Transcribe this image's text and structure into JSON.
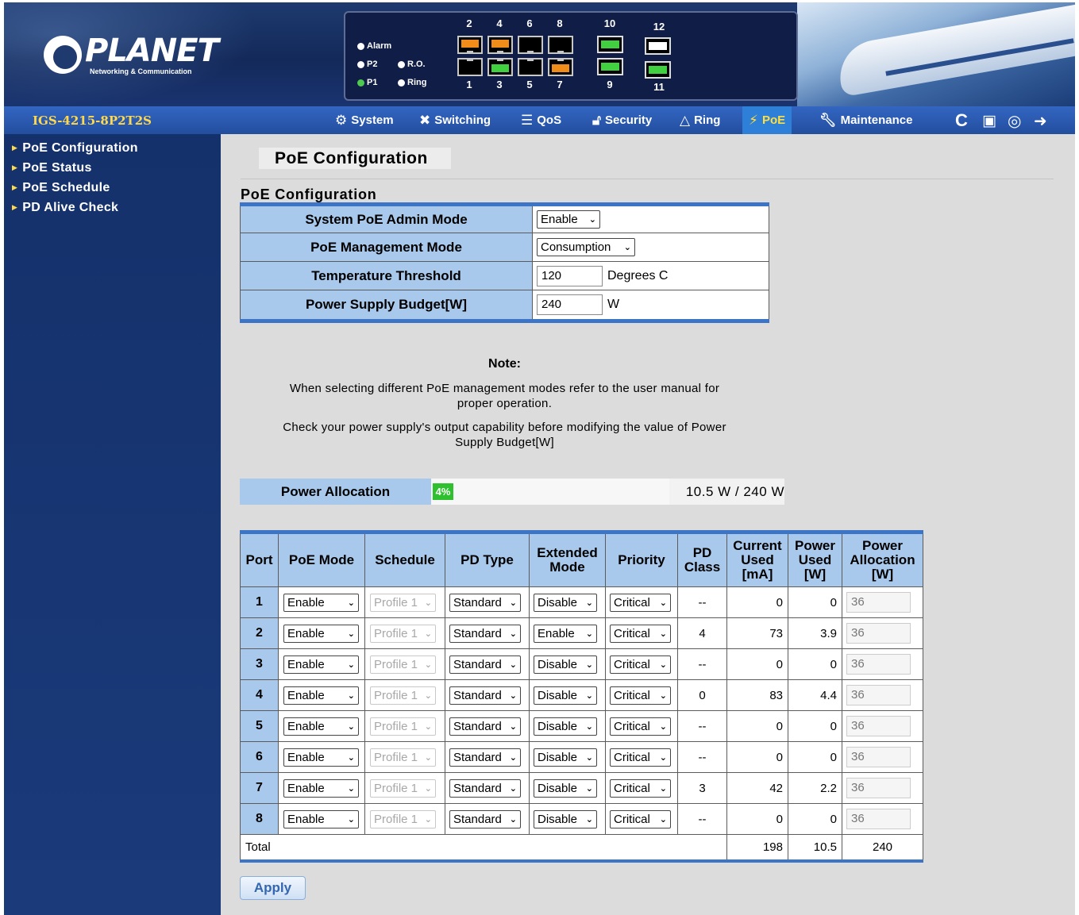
{
  "header": {
    "brand": "PLANET",
    "tagline": "Networking & Communication",
    "model": "IGS-4215-8P2T2S",
    "leds": {
      "alarm": "Alarm",
      "p2": "P2",
      "ro": "R.O.",
      "p1": "P1",
      "ring": "Ring"
    },
    "top_port_numbers": [
      "2",
      "4",
      "6",
      "8",
      "10",
      "12"
    ],
    "bottom_port_numbers": [
      "1",
      "3",
      "5",
      "7",
      "9",
      "11"
    ]
  },
  "nav": {
    "system": "System",
    "switching": "Switching",
    "qos": "QoS",
    "security": "Security",
    "ring": "Ring",
    "poe": "PoE",
    "maintenance": "Maintenance"
  },
  "sidebar": {
    "items": [
      {
        "label": "PoE Configuration"
      },
      {
        "label": "PoE Status"
      },
      {
        "label": "PoE Schedule"
      },
      {
        "label": "PD Alive Check"
      }
    ]
  },
  "page": {
    "title": "PoE Configuration",
    "section_title": "PoE Configuration"
  },
  "config": {
    "admin_mode_label": "System PoE Admin Mode",
    "admin_mode_value": "Enable",
    "mgmt_mode_label": "PoE Management Mode",
    "mgmt_mode_value": "Consumption",
    "temp_label": "Temperature Threshold",
    "temp_value": "120",
    "temp_unit": "Degrees C",
    "budget_label": "Power Supply Budget[W]",
    "budget_value": "240",
    "budget_unit": "W"
  },
  "note": {
    "title": "Note:",
    "line1a": "When selecting different PoE management modes refer to the user manual for",
    "line1b": "proper operation.",
    "line2a": "Check your power supply's output capability before modifying the value of Power",
    "line2b": "Supply Budget[W]"
  },
  "allocation": {
    "label": "Power Allocation",
    "percent_text": "4%",
    "percent": 4,
    "value_text": "10.5 W / 240 W"
  },
  "ports_table": {
    "headers": {
      "port": "Port",
      "poe_mode": "PoE Mode",
      "schedule": "Schedule",
      "pd_type": "PD Type",
      "extended_1": "Extended",
      "extended_2": "Mode",
      "priority": "Priority",
      "pd_class_1": "PD",
      "pd_class_2": "Class",
      "current_1": "Current",
      "current_2": "Used",
      "current_3": "[mA]",
      "power_used_1": "Power",
      "power_used_2": "Used",
      "power_used_3": "[W]",
      "alloc_1": "Power",
      "alloc_2": "Allocation",
      "alloc_3": "[W]"
    },
    "rows": [
      {
        "port": "1",
        "poe_mode": "Enable",
        "schedule": "Profile 1",
        "pd_type": "Standard",
        "extended": "Disable",
        "priority": "Critical",
        "pd_class": "--",
        "current": "0",
        "power_used": "0",
        "allocation": "36"
      },
      {
        "port": "2",
        "poe_mode": "Enable",
        "schedule": "Profile 1",
        "pd_type": "Standard",
        "extended": "Enable",
        "priority": "Critical",
        "pd_class": "4",
        "current": "73",
        "power_used": "3.9",
        "allocation": "36"
      },
      {
        "port": "3",
        "poe_mode": "Enable",
        "schedule": "Profile 1",
        "pd_type": "Standard",
        "extended": "Disable",
        "priority": "Critical",
        "pd_class": "--",
        "current": "0",
        "power_used": "0",
        "allocation": "36"
      },
      {
        "port": "4",
        "poe_mode": "Enable",
        "schedule": "Profile 1",
        "pd_type": "Standard",
        "extended": "Disable",
        "priority": "Critical",
        "pd_class": "0",
        "current": "83",
        "power_used": "4.4",
        "allocation": "36"
      },
      {
        "port": "5",
        "poe_mode": "Enable",
        "schedule": "Profile 1",
        "pd_type": "Standard",
        "extended": "Disable",
        "priority": "Critical",
        "pd_class": "--",
        "current": "0",
        "power_used": "0",
        "allocation": "36"
      },
      {
        "port": "6",
        "poe_mode": "Enable",
        "schedule": "Profile 1",
        "pd_type": "Standard",
        "extended": "Disable",
        "priority": "Critical",
        "pd_class": "--",
        "current": "0",
        "power_used": "0",
        "allocation": "36"
      },
      {
        "port": "7",
        "poe_mode": "Enable",
        "schedule": "Profile 1",
        "pd_type": "Standard",
        "extended": "Disable",
        "priority": "Critical",
        "pd_class": "3",
        "current": "42",
        "power_used": "2.2",
        "allocation": "36"
      },
      {
        "port": "8",
        "poe_mode": "Enable",
        "schedule": "Profile 1",
        "pd_type": "Standard",
        "extended": "Disable",
        "priority": "Critical",
        "pd_class": "--",
        "current": "0",
        "power_used": "0",
        "allocation": "36"
      }
    ],
    "total": {
      "label": "Total",
      "current": "198",
      "power_used": "10.5",
      "allocation": "240"
    }
  },
  "apply_label": "Apply",
  "colors": {
    "nav_bg": "#234e9e",
    "header_cell": "#a9c9ec",
    "table_border_accent": "#3d75c6",
    "model_text": "#ffd94d",
    "progress_fill": "#2ec02e",
    "port_orange": "#f08c1a",
    "port_green": "#40d040"
  }
}
